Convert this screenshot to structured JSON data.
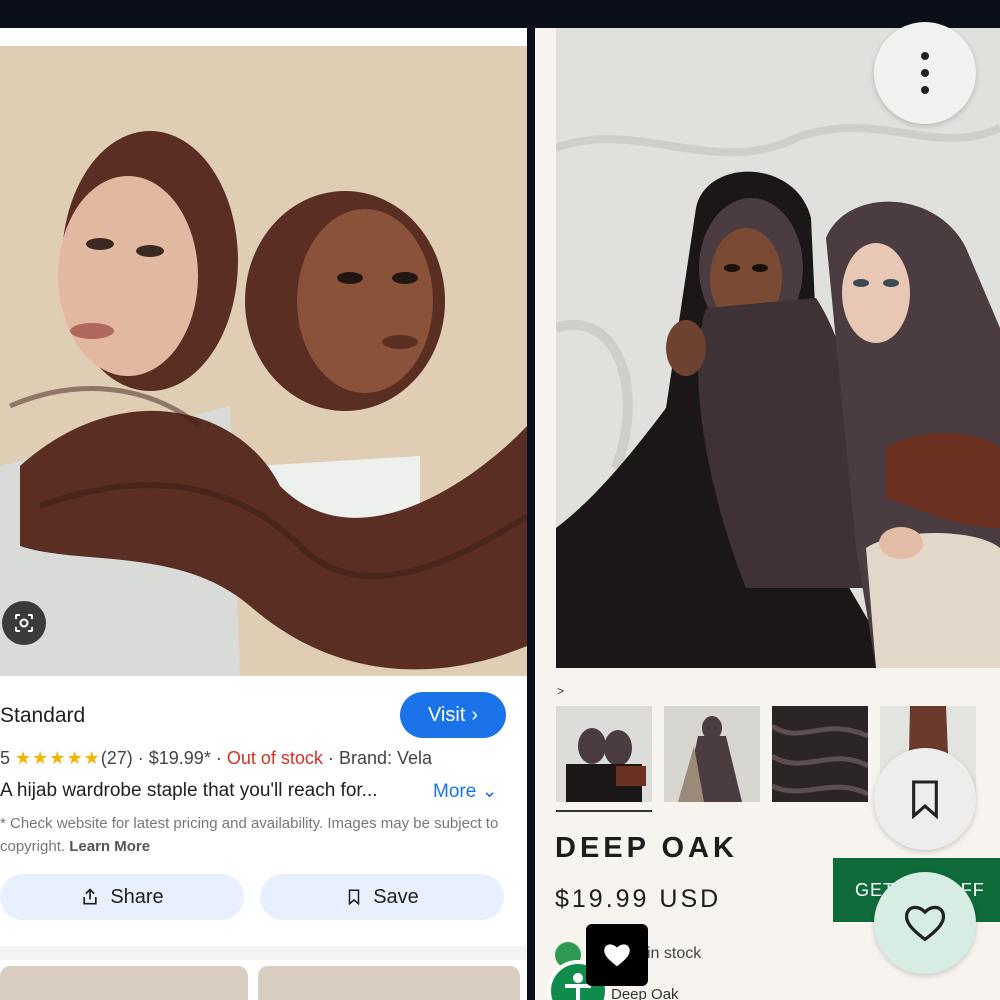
{
  "left": {
    "title": "Standard",
    "visit_label": "Visit",
    "visit_chevron": "›",
    "rating_value": "5",
    "stars": "★★★★★",
    "review_count": "(27)",
    "price": "$19.99*",
    "sep": "·",
    "stock": "Out of stock",
    "brand": "Brand: Vela",
    "description": "A hijab wardrobe staple that you'll reach for...",
    "more_label": "More",
    "more_chevron": "⌄",
    "note": "* Check website for latest pricing and availability. Images may be subject to copyright.",
    "learn_more": "Learn More",
    "share_label": "Share",
    "save_label": "Save"
  },
  "right": {
    "breadcrumb_chevron": ">",
    "product_name": "DEEP OAK",
    "price": "$19.99 USD",
    "cta_label": "GET 10% OFF",
    "stock_text": "in stock",
    "variant_peek": "Deep Oak"
  },
  "colors": {
    "accent_blue": "#1a73e8",
    "out_of_stock_red": "#d93025",
    "star_yellow": "#f4b400",
    "cta_green": "#0f6b3a",
    "hijab_brown_left": "#5a2e22",
    "hijab_plum_right": "#4a3c40"
  },
  "icons": {
    "lens": "google-lens-icon",
    "share": "share-icon",
    "save": "bookmark-outline-icon",
    "menu": "more-vert-icon",
    "bookmark": "bookmark-icon",
    "heart": "heart-outline-icon",
    "black_heart": "heart-filled-icon"
  }
}
